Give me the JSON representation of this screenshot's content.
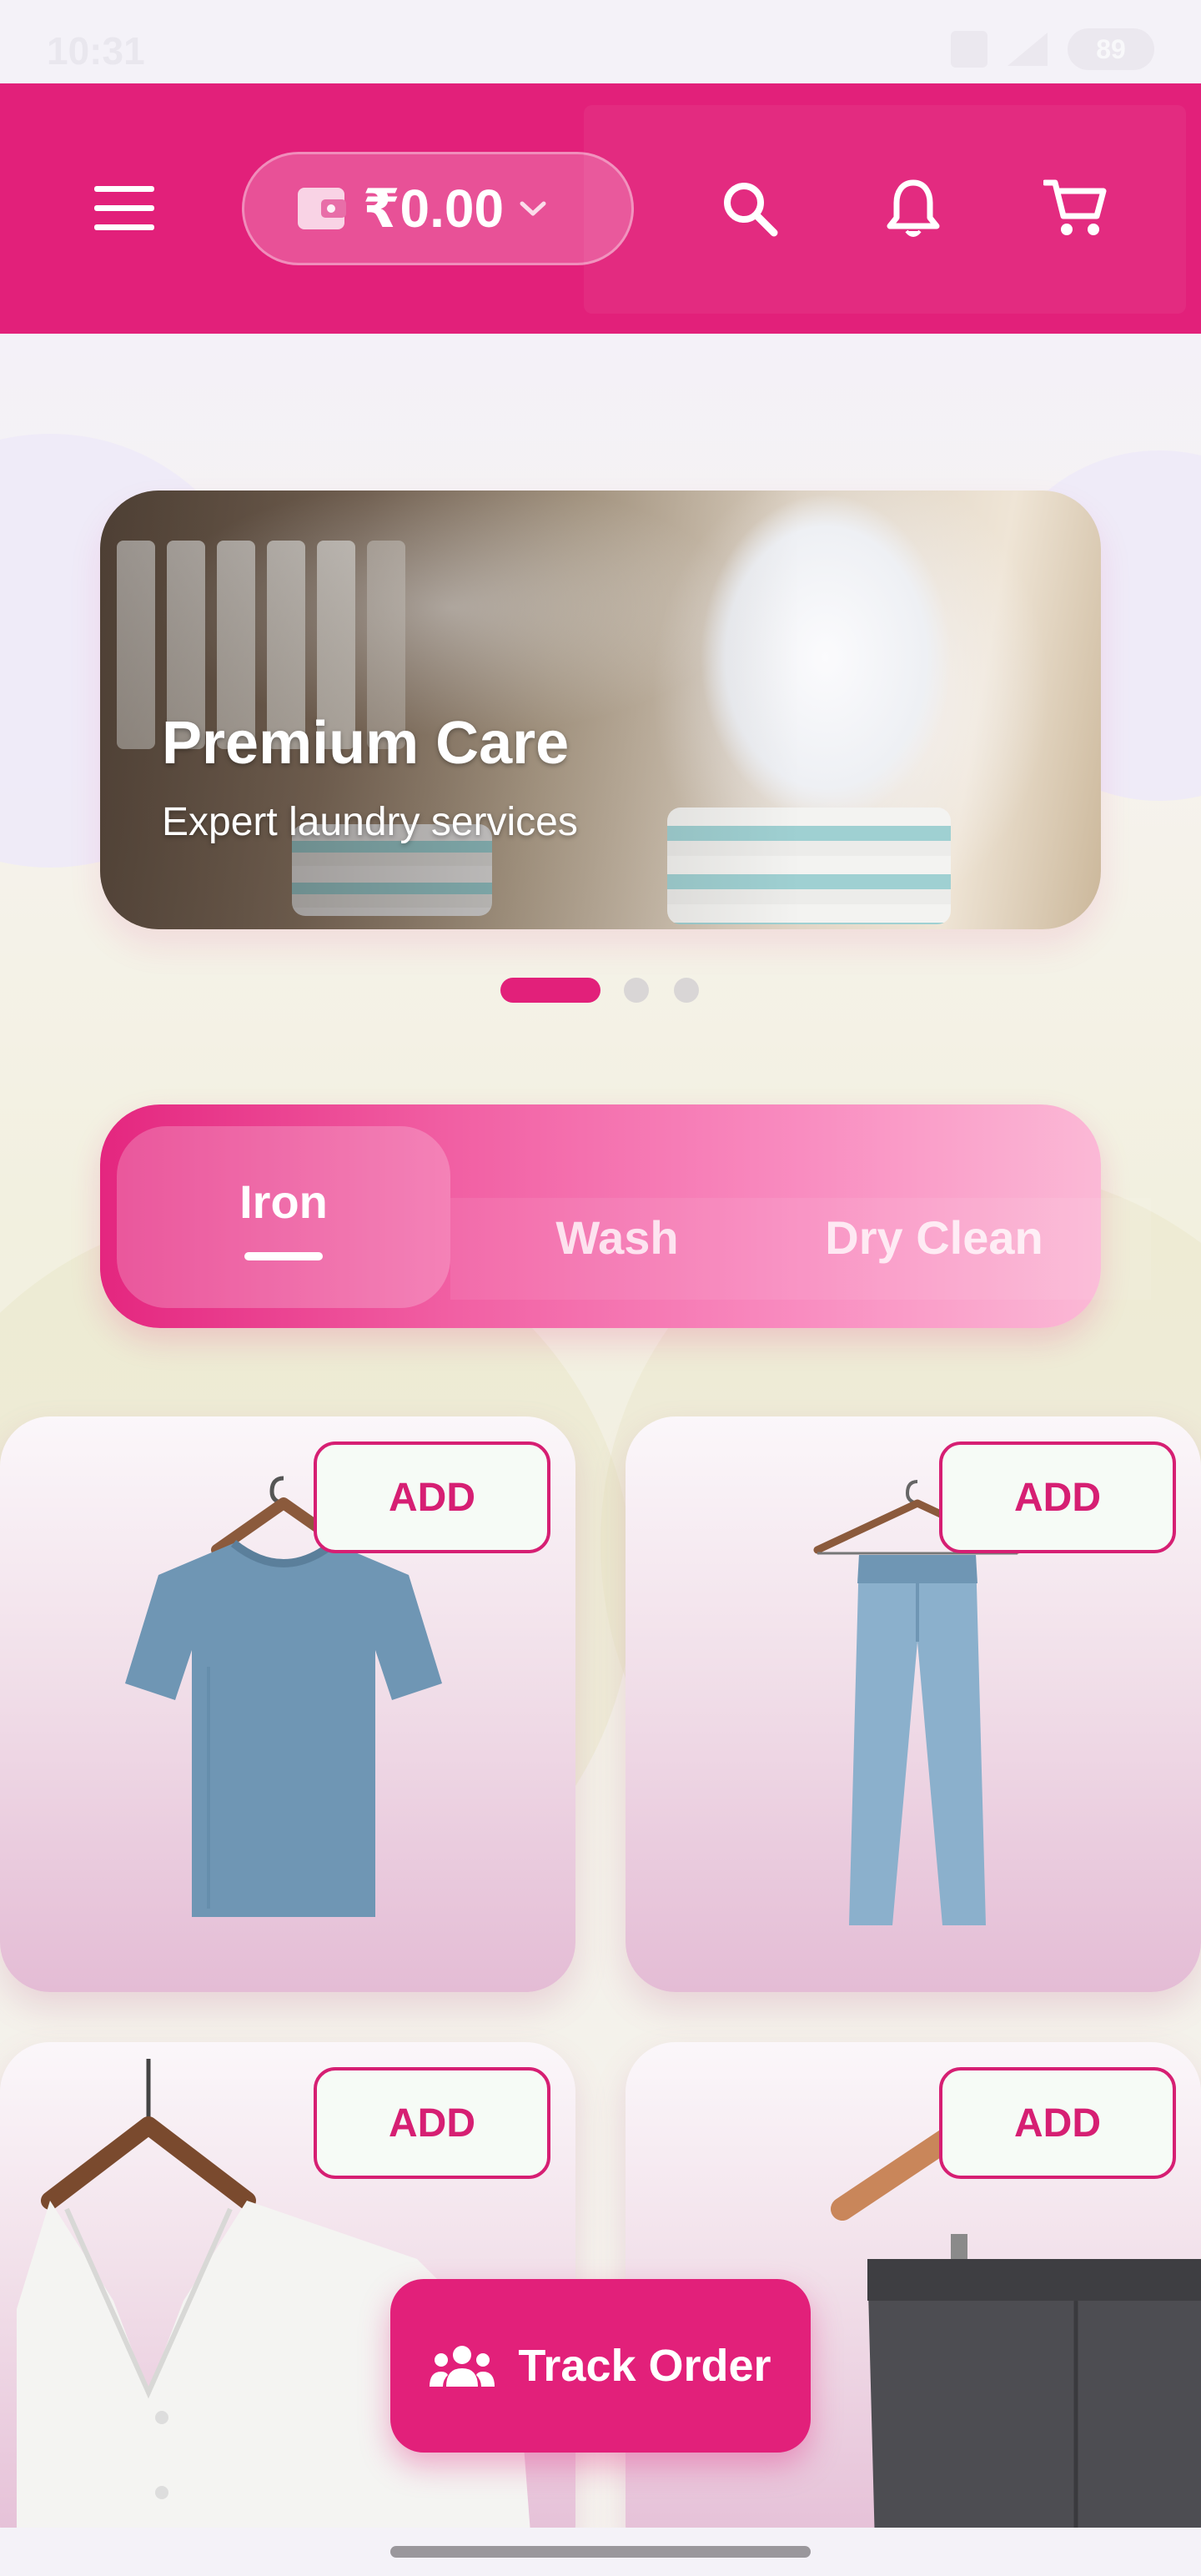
{
  "status_bar": {
    "time": "10:31",
    "battery": "89"
  },
  "header": {
    "wallet_amount": "₹0.00",
    "icons": [
      "menu-icon",
      "wallet-icon",
      "chevron-down-icon",
      "search-icon",
      "bell-icon",
      "cart-icon"
    ]
  },
  "banner": {
    "title": "Premium Care",
    "subtitle": "Expert laundry services",
    "page_count": 3,
    "active_page": 1
  },
  "service_tabs": {
    "items": [
      {
        "label": "Iron",
        "selected": true
      },
      {
        "label": "Wash",
        "selected": false
      },
      {
        "label": "Dry Clean",
        "selected": false
      }
    ]
  },
  "products": [
    {
      "item": "t-shirt",
      "add_label": "ADD"
    },
    {
      "item": "jeans",
      "add_label": "ADD"
    },
    {
      "item": "shirt",
      "add_label": "ADD"
    },
    {
      "item": "trousers",
      "add_label": "ADD"
    }
  ],
  "fab": {
    "label": "Track Order",
    "icon": "group-icon"
  },
  "colors": {
    "brand": "#e2207a",
    "tab_gradient_end": "#fbb9d6",
    "add_button_border": "#d61f73"
  }
}
